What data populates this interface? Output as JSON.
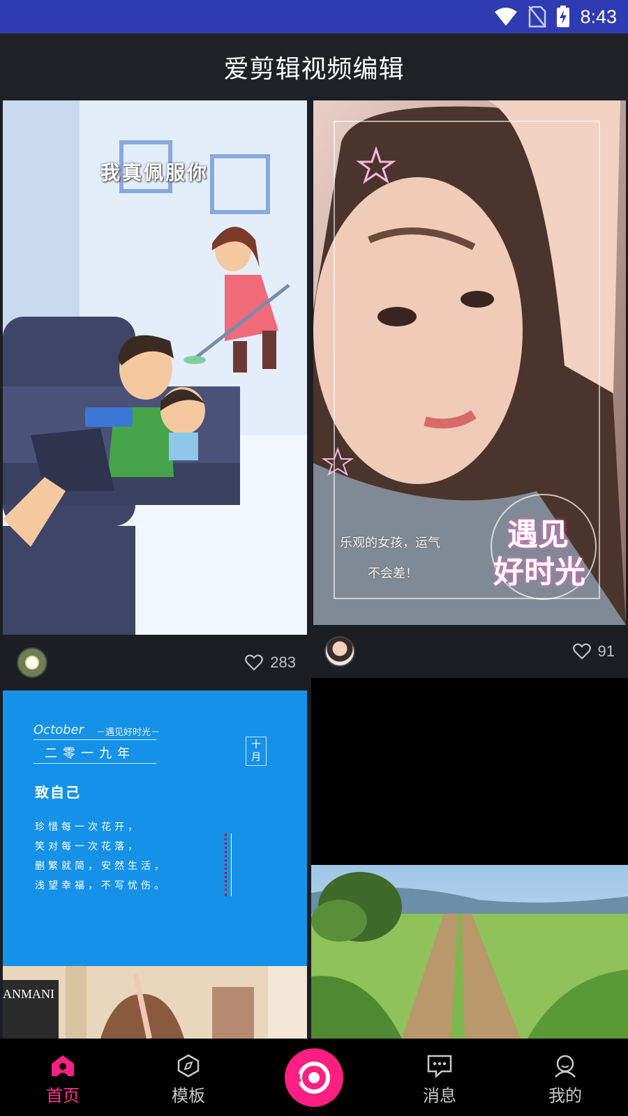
{
  "status_bar": {
    "time": "8:43",
    "icons": [
      "wifi-icon",
      "no-sim-icon",
      "battery-charging-icon"
    ]
  },
  "app": {
    "title": "爱剪辑视频编辑"
  },
  "feed": {
    "cards": [
      {
        "overlay_text": "我真佩服你",
        "likes": "283",
        "avatar": "flower-avatar"
      },
      {
        "overlay_text_1": "乐观的女孩，运气",
        "overlay_text_2": "不会差！",
        "stamp_text_1": "遇见",
        "stamp_text_2": "好时光",
        "likes": "91",
        "avatar": "girl-avatar"
      },
      {
        "month_en": "October",
        "subtitle": "－遇见好时光－",
        "year": "二零一九年",
        "month_cn_1": "十",
        "month_cn_2": "月",
        "heading": "致自己",
        "lines": [
          "珍惜每一次花开，",
          "笑对每一次花落，",
          "删繁就简，安然生活，",
          "浅望幸福，不写忧伤。"
        ],
        "shop_sign": "ANMANI"
      },
      {
        "scene": "country-road"
      }
    ]
  },
  "bottom_nav": {
    "items": [
      {
        "label": "首页",
        "icon": "home-icon",
        "active": true
      },
      {
        "label": "模板",
        "icon": "template-icon",
        "active": false
      },
      {
        "label": "",
        "icon": "camera-record-icon",
        "active": false
      },
      {
        "label": "消息",
        "icon": "message-icon",
        "active": false
      },
      {
        "label": "我的",
        "icon": "profile-icon",
        "active": false
      }
    ]
  },
  "colors": {
    "accent": "#ff1f82",
    "status_bar": "#2f3bb0",
    "background": "#1b1e22"
  }
}
